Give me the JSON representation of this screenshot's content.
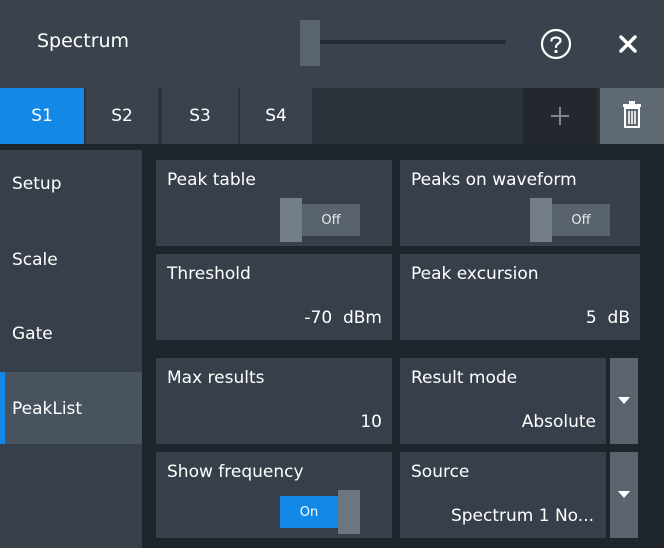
{
  "window": {
    "title": "Spectrum",
    "help_icon": "question-circle-icon",
    "close_icon": "close-icon"
  },
  "tabs": [
    {
      "label": "S1",
      "active": true
    },
    {
      "label": "S2",
      "active": false
    },
    {
      "label": "S3",
      "active": false
    },
    {
      "label": "S4",
      "active": false
    }
  ],
  "tab_actions": {
    "add_label": "+",
    "delete_icon": "trash-icon"
  },
  "nav": {
    "items": [
      {
        "label": "Setup"
      },
      {
        "label": "Scale"
      },
      {
        "label": "Gate"
      },
      {
        "label": "PeakList",
        "active": true
      }
    ]
  },
  "settings": {
    "peak_table": {
      "label": "Peak table",
      "state": "Off"
    },
    "peaks_on_waveform": {
      "label": "Peaks on waveform",
      "state": "Off"
    },
    "threshold": {
      "label": "Threshold",
      "value": "-70  dBm"
    },
    "peak_excursion": {
      "label": "Peak excursion",
      "value": "5  dB"
    },
    "max_results": {
      "label": "Max results",
      "value": "10"
    },
    "result_mode": {
      "label": "Result mode",
      "value": "Absolute"
    },
    "show_frequency": {
      "label": "Show frequency",
      "state": "On"
    },
    "source": {
      "label": "Source",
      "value": "Spectrum 1 No..."
    }
  },
  "colors": {
    "accent": "#1488e6",
    "background": "#1e242b",
    "card": "#37404a"
  }
}
